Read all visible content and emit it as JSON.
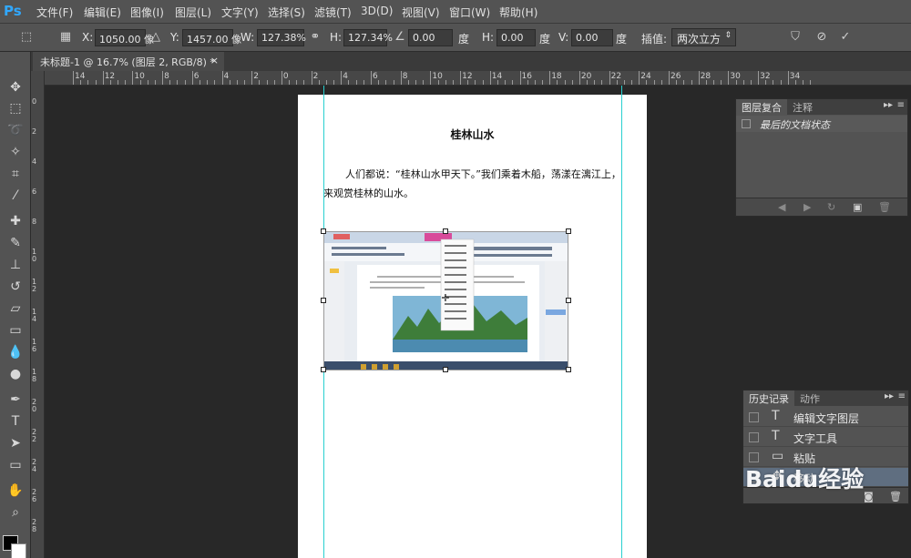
{
  "app": {
    "logo": "Ps"
  },
  "menu": [
    "文件(F)",
    "编辑(E)",
    "图像(I)",
    "图层(L)",
    "文字(Y)",
    "选择(S)",
    "滤镜(T)",
    "3D(D)",
    "视图(V)",
    "窗口(W)",
    "帮助(H)"
  ],
  "options": {
    "x_label": "X:",
    "x_value": "1050.00 像",
    "y_label": "Y:",
    "y_value": "1457.00 像",
    "w_label": "W:",
    "w_value": "127.38%",
    "h_label": "H:",
    "h_value": "127.34%",
    "angle_value": "0.00",
    "angle_unit": "度",
    "hskew_label": "H:",
    "hskew_value": "0.00",
    "hskew_unit": "度",
    "vskew_label": "V:",
    "vskew_value": "0.00",
    "vskew_unit": "度",
    "interp_label": "插值:",
    "interp_value": "两次立方"
  },
  "document_tab": {
    "title": "未标题-1 @ 16.7% (图层 2, RGB/8) *",
    "close": "×"
  },
  "ruler": {
    "top_numbers": [
      "14",
      "12",
      "10",
      "8",
      "6",
      "4",
      "2",
      "0",
      "2",
      "4",
      "6",
      "8",
      "10",
      "12",
      "14",
      "16",
      "18",
      "20",
      "22",
      "24",
      "26",
      "28",
      "30",
      "32",
      "34"
    ],
    "left_numbers": [
      "0",
      "2",
      "4",
      "6",
      "8",
      "10",
      "12",
      "14",
      "16",
      "18",
      "20",
      "22",
      "24",
      "26",
      "28"
    ]
  },
  "canvas": {
    "title": "桂林山水",
    "body": "人们都说：“桂林山水甲天下。”我们乘着木船，荡漾在漓江上，来观赏桂林的山水。"
  },
  "layer_comps_panel": {
    "tabs": [
      "图层复合",
      "注释"
    ],
    "row": "最后的文档状态"
  },
  "history_panel": {
    "tabs": [
      "历史记录",
      "动作"
    ],
    "items": [
      {
        "label": "编辑文字图层",
        "icon": "T"
      },
      {
        "label": "文字工具",
        "icon": "T"
      },
      {
        "label": "粘贴",
        "icon": "▭"
      },
      {
        "label": "移动",
        "icon": "✥"
      }
    ]
  },
  "watermark": "Baidu经验",
  "colors": {
    "foreground": "#000000",
    "background": "#ffffff",
    "guide": "#27d0d0",
    "accent": "#31a8ff"
  }
}
